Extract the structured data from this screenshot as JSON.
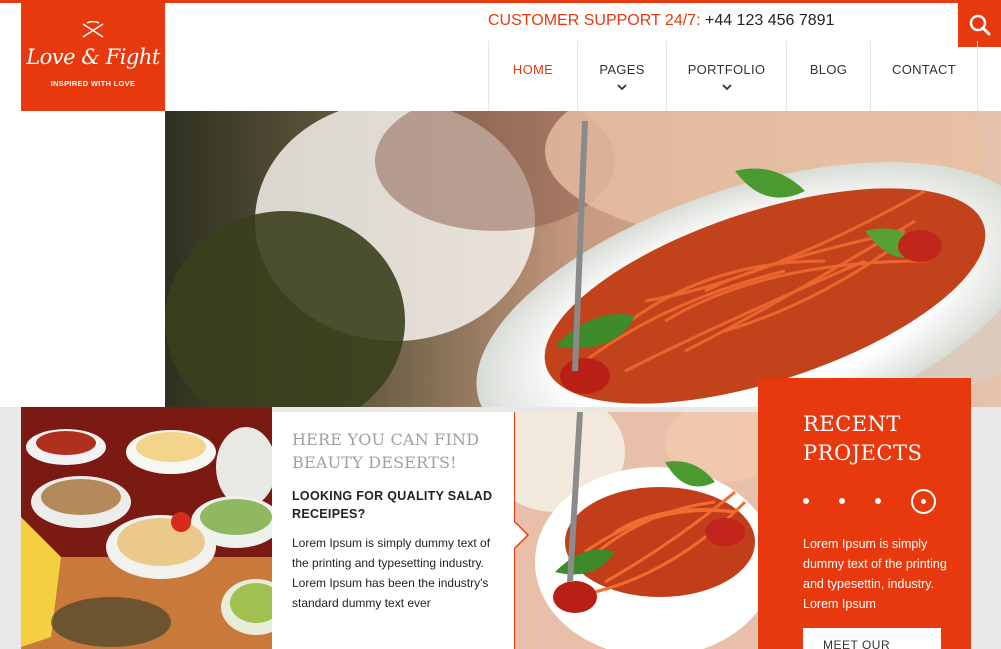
{
  "brand": {
    "name": "Love & Fight",
    "tagline": "INSPIRED WITH LOVE",
    "accent": "#e8380d"
  },
  "support": {
    "label": "CUSTOMER SUPPORT 24/7:",
    "phone": "+44 123 456 7891"
  },
  "search": {
    "icon": "search-icon"
  },
  "nav": {
    "home": "HOME",
    "pages": "PAGES",
    "portfolio": "PORTFOLIO",
    "blog": "BLOG",
    "contact": "CONTACT"
  },
  "feature": {
    "title": "HERE YOU CAN FIND BEAUTY DESERTS!",
    "subtitle": "LOOKING FOR QUALITY SALAD RECEIPES?",
    "body": "Lorem Ipsum is simply dummy text of the printing and typesetting industry. Lorem Ipsum has been the industry's standard dummy text ever"
  },
  "recent": {
    "title": "RECENT PROJECTS",
    "text": "Lorem Ipsum is simply dummy text of the printing and typesettin, industry. Lorem Ipsum",
    "button": "MEET OUR"
  }
}
